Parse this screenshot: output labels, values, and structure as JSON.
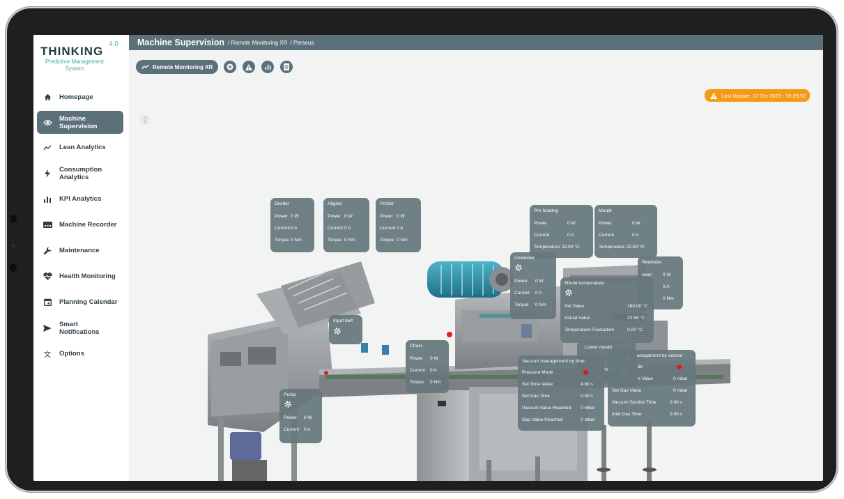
{
  "app": {
    "logo_main": "THINKING",
    "logo_version": "4.0",
    "logo_sub": "Predictive Management System"
  },
  "nav": [
    {
      "label": "Homepage",
      "icon": "home-icon"
    },
    {
      "label": "Machine Supervision",
      "icon": "eye-icon",
      "active": true
    },
    {
      "label": "Lean Analytics",
      "icon": "trend-icon"
    },
    {
      "label": "Consumption Analytics",
      "icon": "bolt-icon"
    },
    {
      "label": "KPI Analytics",
      "icon": "bar-chart-icon"
    },
    {
      "label": "Machine Recorder",
      "icon": "recorder-icon"
    },
    {
      "label": "Maintenance",
      "icon": "wrench-icon"
    },
    {
      "label": "Health Monitoring",
      "icon": "heart-pulse-icon"
    },
    {
      "label": "Planning Calendar",
      "icon": "calendar-icon"
    },
    {
      "label": "Smart Notifications",
      "icon": "send-icon"
    },
    {
      "label": "Options",
      "icon": "translate-icon"
    }
  ],
  "header": {
    "title": "Machine Supervision",
    "crumb1": "/ Remote Monitoring XR",
    "crumb2": "/ Perseus"
  },
  "toolbar": {
    "main_label": "Remote Monitoring XR",
    "buttons": [
      "close-circle-icon",
      "warning-icon",
      "bar-chart-icon",
      "document-icon"
    ]
  },
  "last_update": "Last Update: 17 Oct 2023 - 16:29:52",
  "colors": {
    "accent": "#5b7079",
    "warning": "#f49a15",
    "alarm": "#e8161a",
    "brand": "#4bb0a4"
  },
  "panels": {
    "divider": {
      "title": "Divider",
      "power_label": "Power",
      "power": "0 W",
      "current_label": "Current",
      "current": "0 A",
      "torque_label": "Torque",
      "torque": "0 Nm"
    },
    "aligner": {
      "title": "Aligner",
      "power_label": "Power",
      "power": "0 W",
      "current_label": "Current",
      "current": "0 A",
      "torque_label": "Torque",
      "torque": "0 Nm"
    },
    "printer": {
      "title": "Printer",
      "power_label": "Power",
      "power": "0 W",
      "current_label": "Current",
      "current": "0 A",
      "torque_label": "Torque",
      "torque": "0 Nm"
    },
    "preheating": {
      "title": "Pre heating",
      "power_label": "Power",
      "power": "0 W",
      "current_label": "Current",
      "current": "0 A",
      "temp_label": "Temperature",
      "temp": "22.90 °C"
    },
    "mould": {
      "title": "Mould",
      "power_label": "Power",
      "power": "0 W",
      "current_label": "Current",
      "current": "0 A",
      "temp_label": "Temperature",
      "temp": "22.50 °C"
    },
    "unwinder": {
      "title": "Unwinder",
      "power_label": "Power",
      "power": "0 W",
      "current_label": "Current",
      "current": "0 A",
      "torque_label": "Torque",
      "torque": "0 Nm"
    },
    "rewinder": {
      "title": "Rewinder",
      "power_label": "ower",
      "power": "0 W",
      "current_label": "nt",
      "current": "0 A",
      "torque_label": "e",
      "torque": "0 Nm"
    },
    "mould_temp": {
      "title": "Mould temperature",
      "set_label": "Set Value",
      "set": "160.00 °C",
      "actual_label": "Actual Value",
      "actual": "22.50 °C",
      "fluct_label": "Temperature Fluctuation",
      "fluct": "0.00 °C"
    },
    "input_belt": {
      "title": "Input belt"
    },
    "chain": {
      "title": "Chain",
      "power_label": "Power",
      "power": "0 W",
      "current_label": "Current",
      "current": "0 A",
      "torque_label": "Torque",
      "torque": "0 Nm"
    },
    "lower_mould": {
      "title": "Lower mould",
      "surfaces_label": "rfaces"
    },
    "vac_time": {
      "title": "Vacuum management by time",
      "pressure_label": "Pressure Mode",
      "settime_label": "Set Time Value",
      "settime": "4.80 s",
      "gastime_label": "Set Gas Time",
      "gastime": "0.00 s",
      "vacreached_label": "Vacuum Value Reached",
      "vacreached": "0 mbar",
      "gasreached_label": "Gas Value Reached",
      "gasreached": "0 mbar"
    },
    "vac_sensor": {
      "title": "anagement by sensor",
      "mode_label": "de",
      "value_label": "n Value",
      "value": "0 mbar",
      "gas_label": "Set Gas Value",
      "gas": "0 mbar",
      "suction_label": "Vacuum Suction Time",
      "suction": "0.00 s",
      "inlet_label": "Inlet Gas Time",
      "inlet": "0.00 s"
    },
    "pump": {
      "title": "Pump",
      "power_label": "Power",
      "power": "0 W",
      "current_label": "Current",
      "current": "0 A"
    }
  }
}
